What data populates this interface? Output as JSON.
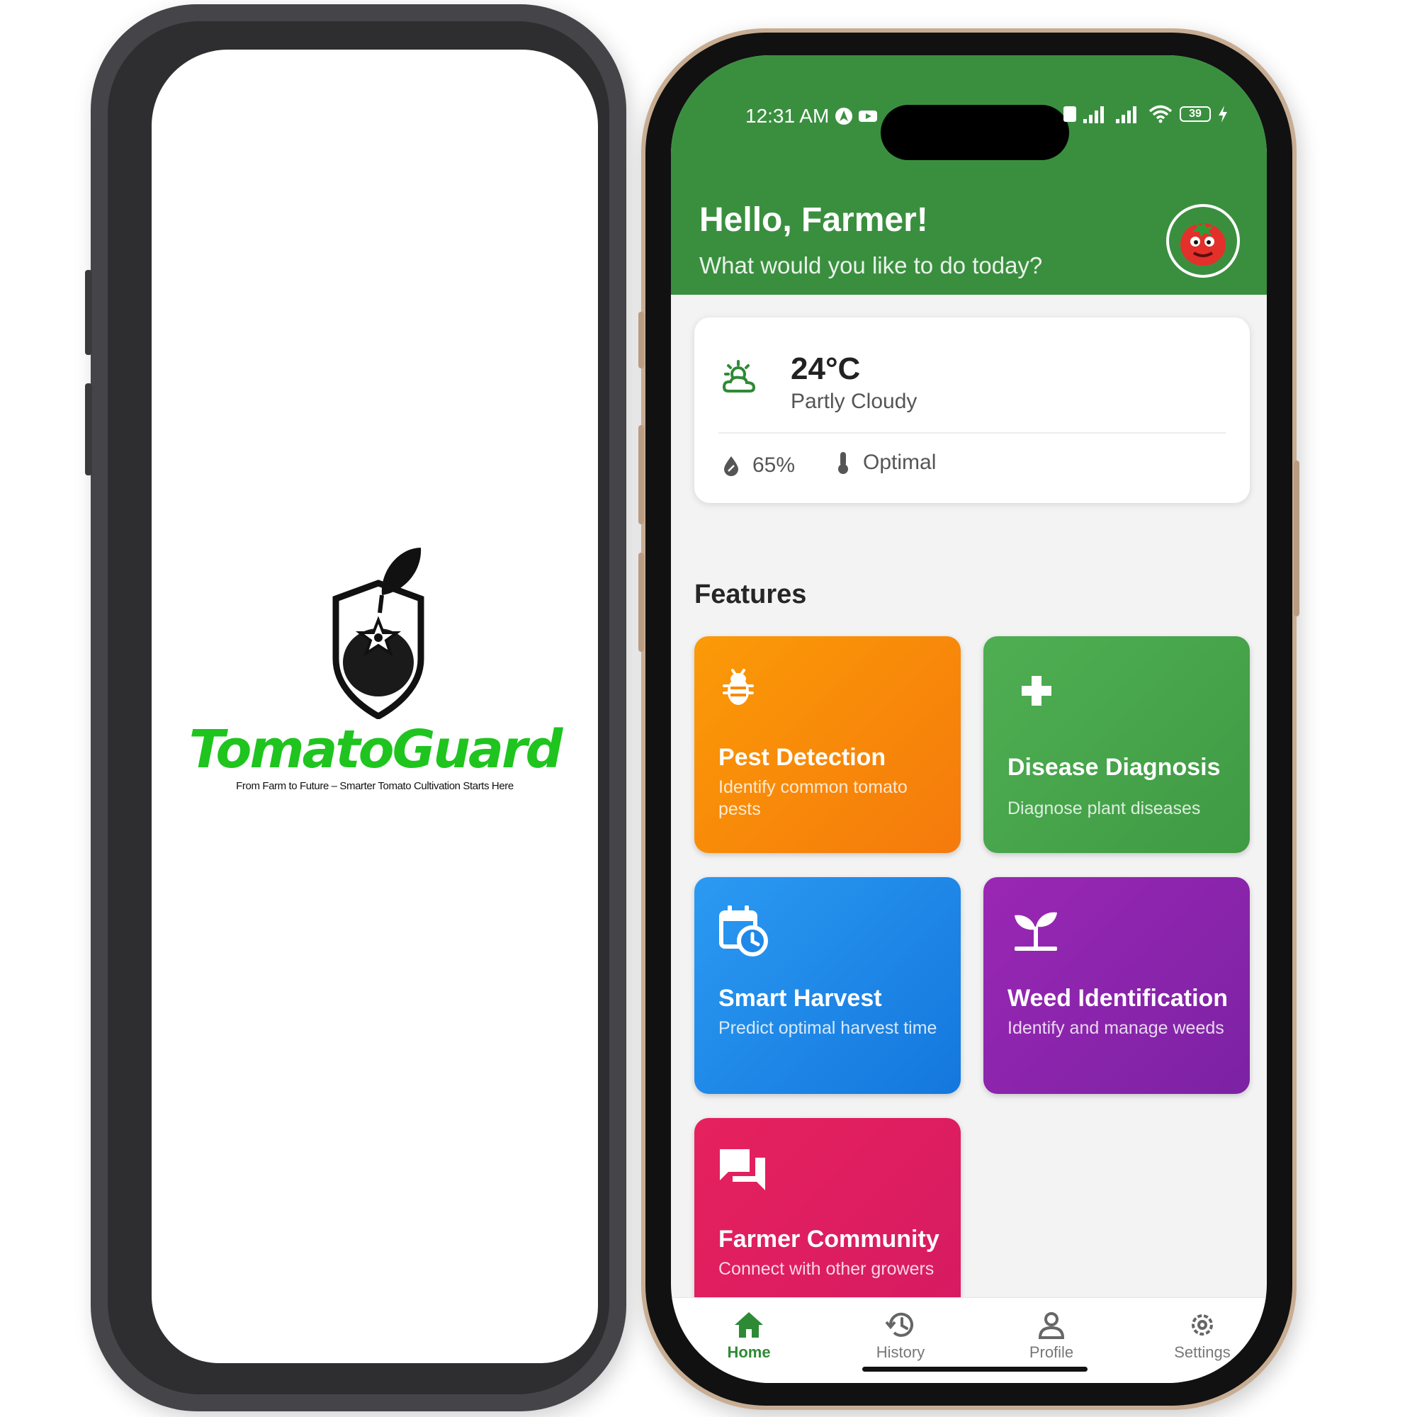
{
  "splash": {
    "brand": "TomatoGuard",
    "tagline": "From Farm to Future – Smarter Tomato Cultivation Starts Here",
    "brand_color": "#1fc41f"
  },
  "status_bar": {
    "time": "12:31 AM",
    "battery": "39"
  },
  "header": {
    "greeting": "Hello, Farmer!",
    "subtitle": "What would you like to do today?",
    "color": "#3a8f3f"
  },
  "weather": {
    "temperature": "24°C",
    "condition": "Partly Cloudy",
    "humidity": "65%",
    "temp_status": "Optimal"
  },
  "features": {
    "title": "Features",
    "items": [
      {
        "title": "Pest Detection",
        "desc": "Identify common tomato pests",
        "icon": "bug-icon",
        "color": "#f78a0a"
      },
      {
        "title": "Disease Diagnosis",
        "desc": "Diagnose plant diseases",
        "icon": "plus-icon",
        "color": "#47a44b"
      },
      {
        "title": "Smart Harvest",
        "desc": "Predict optimal harvest time",
        "icon": "calendar-clock-icon",
        "color": "#1f88e8"
      },
      {
        "title": "Weed Identification",
        "desc": "Identify and manage weeds",
        "icon": "sprout-icon",
        "color": "#8b25ac"
      },
      {
        "title": "Farmer Community",
        "desc": "Connect with other growers",
        "icon": "chat-icon",
        "color": "#de1e60"
      }
    ]
  },
  "nav": {
    "items": [
      {
        "label": "Home",
        "icon": "home-icon",
        "active": true
      },
      {
        "label": "History",
        "icon": "history-icon",
        "active": false
      },
      {
        "label": "Profile",
        "icon": "profile-icon",
        "active": false
      },
      {
        "label": "Settings",
        "icon": "settings-icon",
        "active": false
      }
    ]
  }
}
